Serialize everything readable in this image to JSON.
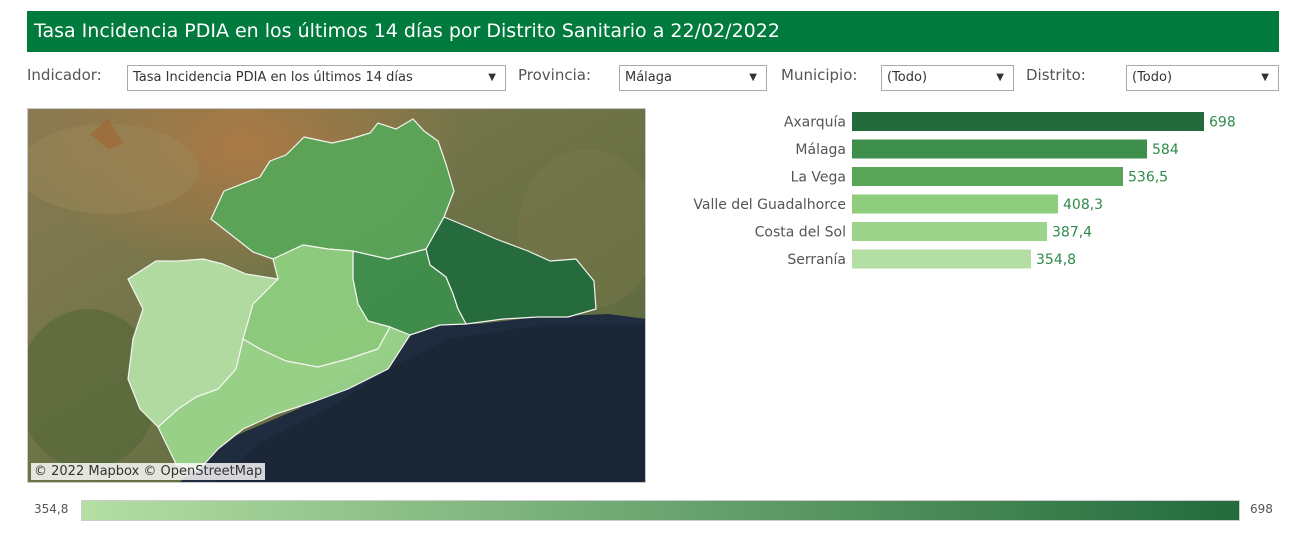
{
  "title": "Tasa Incidencia PDIA en los últimos 14 días por Distrito Sanitario a 22/02/2022",
  "filters": {
    "indicador": {
      "label": "Indicador:",
      "value": "Tasa Incidencia PDIA en los últimos 14 días"
    },
    "provincia": {
      "label": "Provincia:",
      "value": "Málaga"
    },
    "municipio": {
      "label": "Municipio:",
      "value": "(Todo)"
    },
    "distrito": {
      "label": "Distrito:",
      "value": "(Todo)"
    }
  },
  "map": {
    "attribution": "© 2022 Mapbox © OpenStreetMap",
    "regions": [
      {
        "name": "Axarquía",
        "color": "#236b3c"
      },
      {
        "name": "Málaga",
        "color": "#3e8f4c"
      },
      {
        "name": "La Vega",
        "color": "#59a457"
      },
      {
        "name": "Valle del Guadalhorce",
        "color": "#8fcd7e"
      },
      {
        "name": "Costa del Sol",
        "color": "#9bd48a"
      },
      {
        "name": "Serranía",
        "color": "#b4dfa4"
      }
    ]
  },
  "chart_data": {
    "type": "bar",
    "orientation": "horizontal",
    "categories": [
      "Axarquía",
      "Málaga",
      "La Vega",
      "Valle del Guadalhorce",
      "Costa del Sol",
      "Serranía"
    ],
    "values": [
      698,
      584,
      536.5,
      408.3,
      387.4,
      354.8
    ],
    "value_labels": [
      "698",
      "584",
      "536,5",
      "408,3",
      "387,4",
      "354,8"
    ],
    "colors": [
      "#236b3c",
      "#3e8f4c",
      "#59a457",
      "#8fcd7e",
      "#9bd48a",
      "#b4dfa4"
    ],
    "xlim": [
      0,
      698
    ],
    "grid": false
  },
  "color_legend": {
    "min_label": "354,8",
    "max_label": "698",
    "color_start": "#b4dfa4",
    "color_end": "#236b3c"
  },
  "colors": {
    "header_bg": "#007a3d",
    "label_green": "#2e8b4a"
  }
}
